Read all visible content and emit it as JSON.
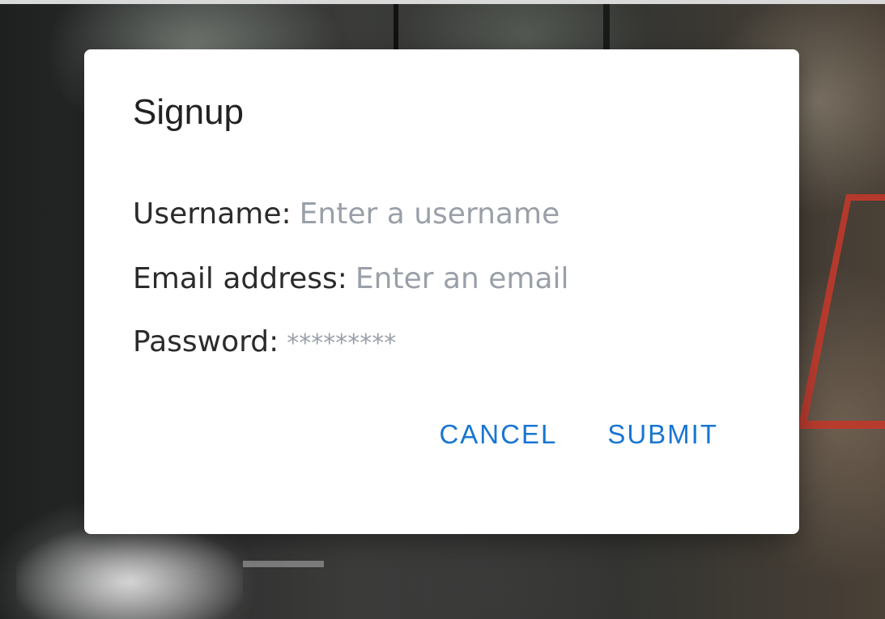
{
  "dialog": {
    "title": "Signup",
    "fields": {
      "username": {
        "label": "Username:",
        "placeholder": "Enter a username",
        "value": ""
      },
      "email": {
        "label": "Email address:",
        "placeholder": "Enter an email",
        "value": ""
      },
      "password": {
        "label": "Password:",
        "placeholder": "*********",
        "value": ""
      }
    },
    "actions": {
      "cancel_label": "CANCEL",
      "submit_label": "SUBMIT"
    }
  },
  "colors": {
    "primary": "#1976d2",
    "placeholder": "#9aa0a8",
    "text": "#2b2b2b",
    "dialog_bg": "#ffffff",
    "accent_red": "#c0392b"
  }
}
